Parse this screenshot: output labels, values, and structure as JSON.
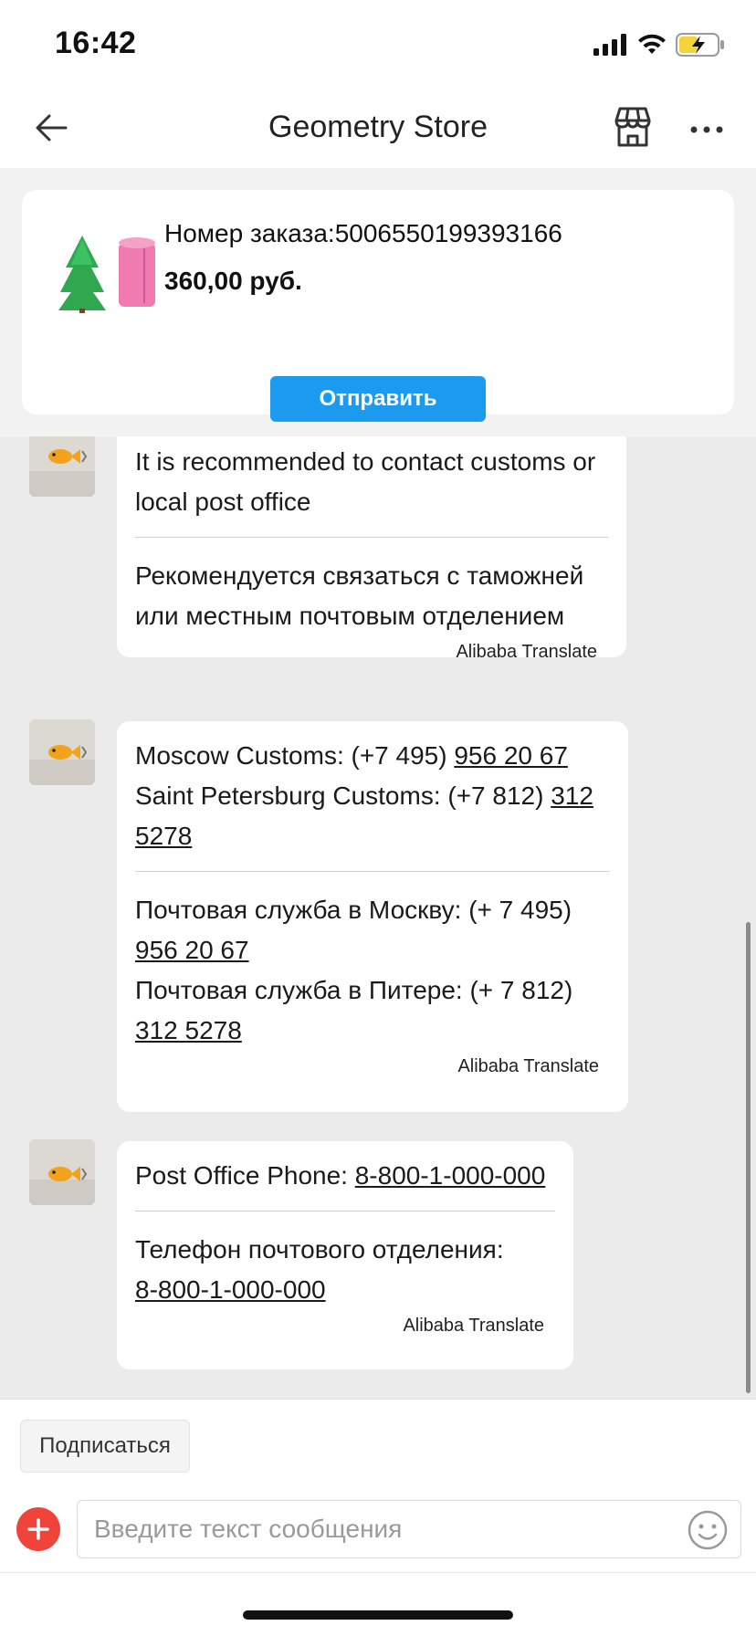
{
  "status_bar": {
    "time": "16:42",
    "icons": [
      "signal-icon",
      "wifi-icon",
      "battery-charging-icon"
    ],
    "battery_color": "#f5d33b"
  },
  "nav": {
    "title": "Geometry Store",
    "icons": [
      "back-arrow-icon",
      "store-icon",
      "more-icon"
    ]
  },
  "order": {
    "number_text": "Номер заказа:5006550199393166",
    "price": "360,00 руб.",
    "send_label": "Отправить",
    "accent_color": "#1a9bf0"
  },
  "messages": [
    {
      "en": "It is recommended to contact customs or local post office",
      "ru": "Рекомендуется связаться с таможней или местным почтовым отделением",
      "translator": "Alibaba Translate"
    },
    {
      "en_lines": [
        {
          "prefix": "Moscow Customs: (+7 495) ",
          "phone": "956 20 67"
        },
        {
          "prefix": "Saint Petersburg Customs: (+7 812) ",
          "phone": "312 5278"
        }
      ],
      "ru_lines": [
        {
          "prefix": "Почтовая служба в Москву: (+ 7 495) ",
          "phone": "956 20 67"
        },
        {
          "prefix": "Почтовая служба в Питере: (+ 7 812) ",
          "phone": "312 5278"
        }
      ],
      "translator": "Alibaba Translate"
    },
    {
      "en_prefix": "Post Office Phone: ",
      "en_phone": "8-800-1-000-000",
      "ru_prefix": "Телефон почтового отделения: ",
      "ru_phone": "8-800-1-000-000",
      "translator": "Alibaba Translate"
    }
  ],
  "bottom": {
    "subscribe_label": "Подписаться",
    "input_placeholder": "Введите текст сообщения",
    "add_color": "#f0433a"
  }
}
